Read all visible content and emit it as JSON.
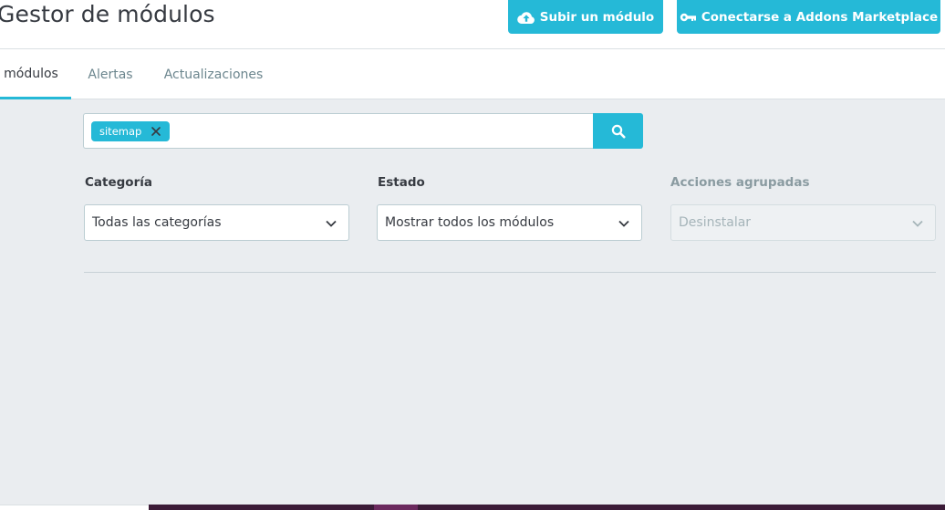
{
  "header": {
    "title": "Gestor de módulos",
    "upload_button": "Subir un módulo",
    "addons_button": "Conectarse a Addons Marketplace"
  },
  "tabs": [
    {
      "label": "módulos",
      "active": true
    },
    {
      "label": "Alertas",
      "active": false
    },
    {
      "label": "Actualizaciones",
      "active": false
    }
  ],
  "search": {
    "tags": [
      "sitemap"
    ],
    "value": ""
  },
  "filters": {
    "category": {
      "label": "Categoría",
      "selected": "Todas las categorías"
    },
    "status": {
      "label": "Estado",
      "selected": "Mostrar todos los módulos"
    },
    "bulk_actions": {
      "label": "Acciones agrupadas",
      "selected": "Desinstalar",
      "disabled": true
    }
  },
  "colors": {
    "accent": "#25b9d7",
    "text": "#363a41",
    "muted": "#6c868e",
    "background": "#eaedf0"
  },
  "icons": {
    "upload": "cloud-upload-icon",
    "addons": "key-icon",
    "search": "search-icon",
    "tag_close": "close-icon",
    "dropdown": "chevron-down-icon"
  }
}
